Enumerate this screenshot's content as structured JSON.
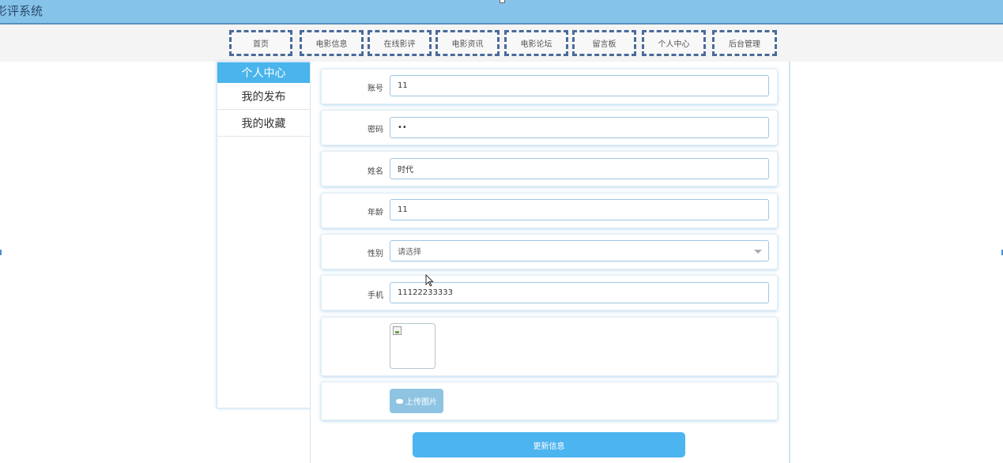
{
  "app": {
    "title": "影评系统"
  },
  "nav": {
    "items": [
      {
        "label": "首页"
      },
      {
        "label": "电影信息"
      },
      {
        "label": "在线影评"
      },
      {
        "label": "电影资讯"
      },
      {
        "label": "电影论坛"
      },
      {
        "label": "留言板"
      },
      {
        "label": "个人中心"
      },
      {
        "label": "后台管理"
      }
    ]
  },
  "sidebar": {
    "header": "个人中心",
    "items": [
      {
        "label": "我的发布"
      },
      {
        "label": "我的收藏"
      }
    ]
  },
  "form": {
    "account": {
      "label": "账号",
      "value": "11"
    },
    "password": {
      "label": "密码",
      "value": "••"
    },
    "name": {
      "label": "姓名",
      "value": "时代"
    },
    "age": {
      "label": "年龄",
      "value": "11"
    },
    "gender": {
      "label": "性别",
      "placeholder": "请选择"
    },
    "phone": {
      "label": "手机",
      "value": "11122233333"
    },
    "upload_label": "上传图片",
    "submit_label": "更新信息"
  },
  "colors": {
    "accent": "#4cb4ef",
    "topbar": "#86c3ea",
    "nav_border": "#4a6a9a"
  }
}
